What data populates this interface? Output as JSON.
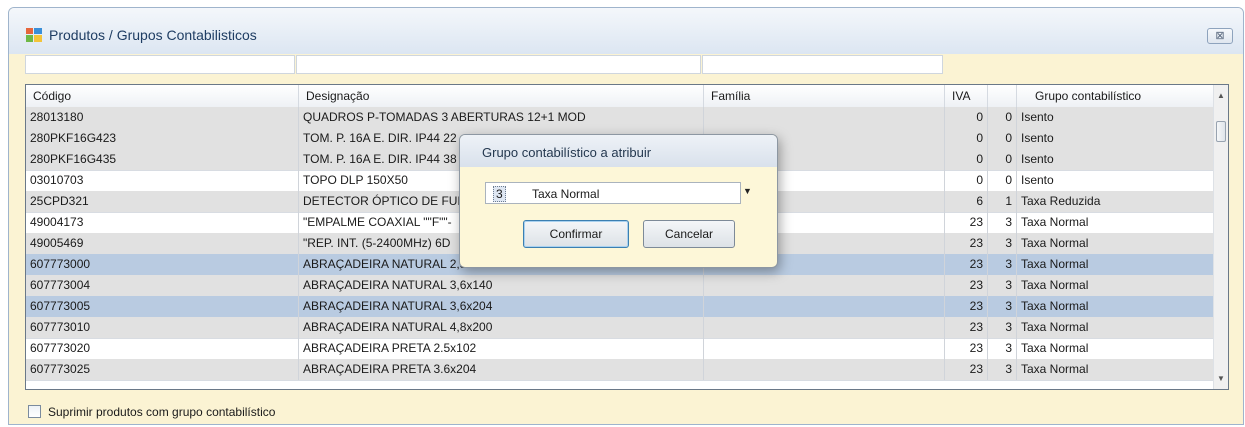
{
  "window": {
    "title": "Produtos / Grupos Contabilisticos",
    "close_label": "⊠"
  },
  "filters": [
    "",
    "",
    ""
  ],
  "grid": {
    "headers": [
      "Código",
      "Designação",
      "Família",
      "IVA",
      "",
      "Grupo contabilístico"
    ],
    "rows": [
      [
        "28013180",
        "QUADROS P-TOMADAS 3 ABERTURAS 12+1 MOD",
        "",
        "0",
        "0",
        "Isento"
      ],
      [
        "280PKF16G423",
        "TOM. P. 16A E. DIR. IP44 22",
        "",
        "0",
        "0",
        "Isento"
      ],
      [
        "280PKF16G435",
        "TOM. P. 16A E. DIR. IP44 38",
        "",
        "0",
        "0",
        "Isento"
      ],
      [
        "03010703",
        "TOPO DLP 150X50",
        "",
        "0",
        "0",
        "Isento"
      ],
      [
        "25CPD321",
        "DETECTOR ÓPTICO DE FUM",
        "",
        "6",
        "1",
        "Taxa Reduzida"
      ],
      [
        "49004173",
        "\"EMPALME COAXIAL \"\"F\"\"-",
        "",
        "23",
        "3",
        "Taxa Normal"
      ],
      [
        "49005469",
        "\"REP. INT. (5-2400MHz) 6D",
        "",
        "23",
        "3",
        "Taxa Normal"
      ],
      [
        "607773000",
        "ABRAÇADEIRA NATURAL 2,5x102",
        "",
        "23",
        "3",
        "Taxa Normal"
      ],
      [
        "607773004",
        "ABRAÇADEIRA NATURAL 3,6x140",
        "",
        "23",
        "3",
        "Taxa Normal"
      ],
      [
        "607773005",
        "ABRAÇADEIRA NATURAL 3,6x204",
        "",
        "23",
        "3",
        "Taxa Normal"
      ],
      [
        "607773010",
        "ABRAÇADEIRA NATURAL 4,8x200",
        "",
        "23",
        "3",
        "Taxa Normal"
      ],
      [
        "607773020",
        "ABRAÇADEIRA PRETA 2.5x102",
        "",
        "23",
        "3",
        "Taxa Normal"
      ],
      [
        "607773025",
        "ABRAÇADEIRA PRETA 3.6x204",
        "",
        "23",
        "3",
        "Taxa Normal"
      ]
    ],
    "row_states": [
      "alt",
      "alt",
      "alt",
      "",
      "alt",
      "",
      "alt",
      "sel",
      "alt",
      "sel",
      "alt",
      "",
      "alt"
    ]
  },
  "footer": {
    "suppress_label": "Suprimir produtos com grupo contabilístico",
    "suppress_checked": false
  },
  "dialog": {
    "title": "Grupo contabilístico a atribuir",
    "combo_code": "3",
    "combo_text": "Taxa Normal",
    "confirm_label": "Confirmar",
    "cancel_label": "Cancelar"
  },
  "colors": {
    "selected_row": "#b9cbe1",
    "alt_row": "#e1e1e1",
    "window_bg": "#fbf3d3",
    "dialog_bg": "#fdf7d8"
  },
  "icons": {
    "window": "app-window-icon",
    "dropdown": "chevron-down-icon",
    "scroll_up": "arrow-up-icon",
    "scroll_down": "arrow-down-icon"
  }
}
